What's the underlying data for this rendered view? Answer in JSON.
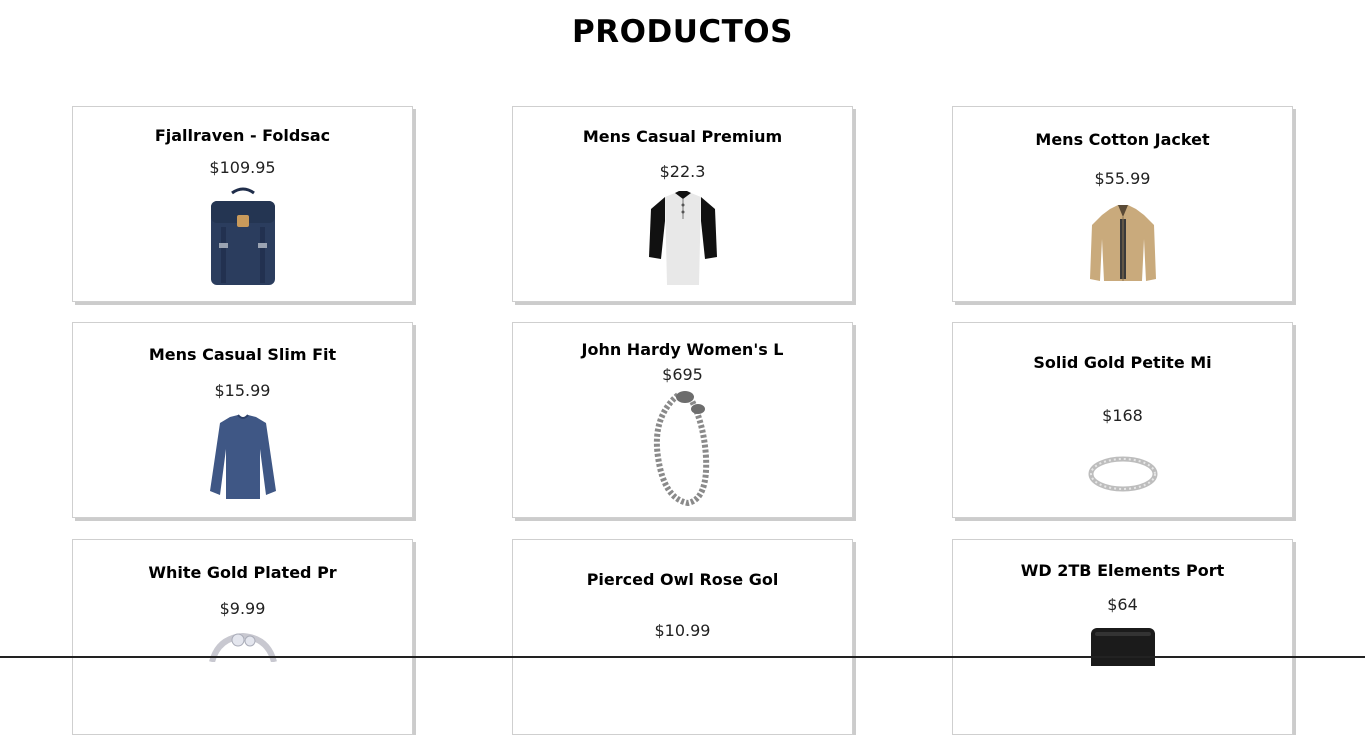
{
  "page": {
    "title": "PRODUCTOS"
  },
  "products": [
    {
      "name": "Fjallraven - Foldsac",
      "price": "$109.95",
      "image": "backpack-image"
    },
    {
      "name": "Mens Casual Premium",
      "price": "$22.3",
      "image": "henley-shirt-image"
    },
    {
      "name": "Mens Cotton Jacket",
      "price": "$55.99",
      "image": "jacket-image"
    },
    {
      "name": "Mens Casual Slim Fit",
      "price": "$15.99",
      "image": "long-sleeve-shirt-image"
    },
    {
      "name": "John Hardy Women's L",
      "price": "$695",
      "image": "bracelet-image"
    },
    {
      "name": "Solid Gold Petite Mi",
      "price": "$168",
      "image": "ring-image"
    },
    {
      "name": "White Gold Plated Pr",
      "price": "$9.99",
      "image": "ring-image"
    },
    {
      "name": "Pierced Owl Rose Gol",
      "price": "$10.99",
      "image": "earrings-image"
    },
    {
      "name": "WD 2TB Elements Port",
      "price": "$64",
      "image": "hard-drive-image"
    }
  ]
}
